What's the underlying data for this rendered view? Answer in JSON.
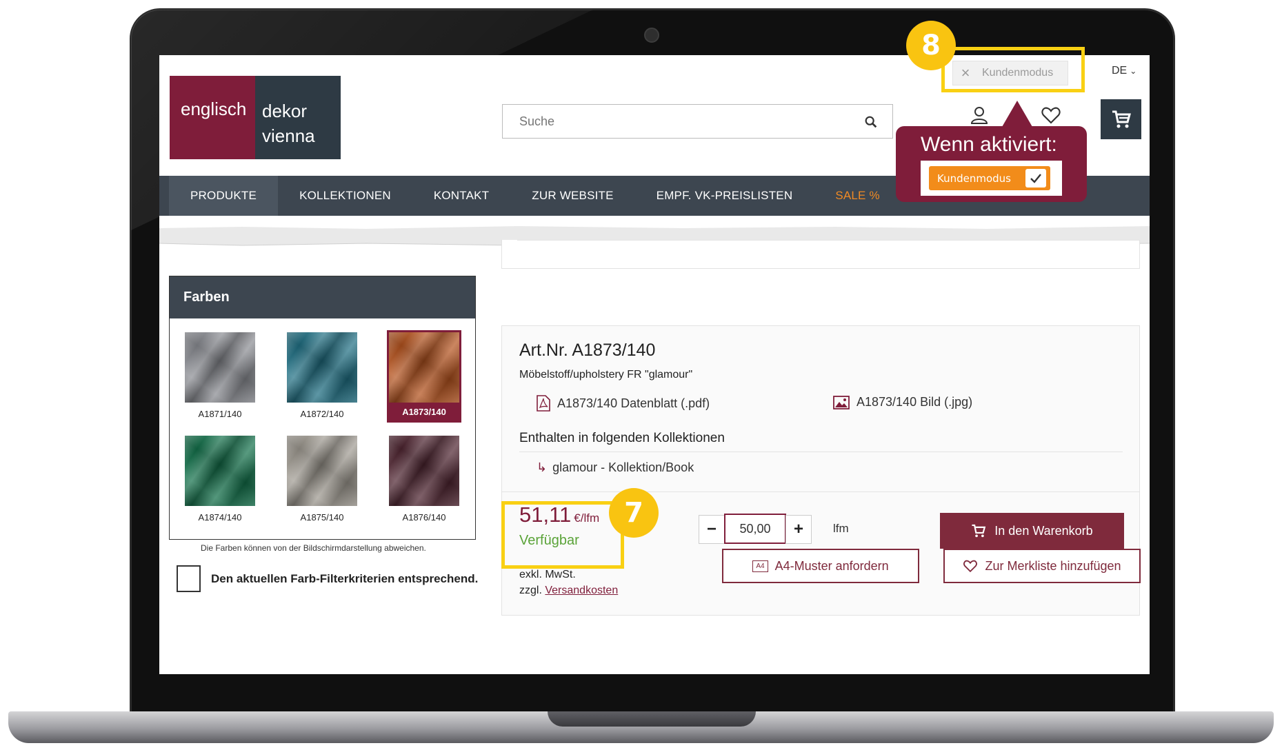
{
  "header": {
    "language": "DE",
    "logo": {
      "left": "englisch",
      "right_top": "dekor",
      "right_bottom": "vienna"
    },
    "search": {
      "placeholder": "Suche"
    },
    "kundenmodus": {
      "label": "Kundenmodus"
    }
  },
  "nav": {
    "items": [
      {
        "label": "PRODUKTE"
      },
      {
        "label": "KOLLEKTIONEN"
      },
      {
        "label": "KONTAKT"
      },
      {
        "label": "ZUR WEBSITE"
      },
      {
        "label": "EMPF. VK-PREISLISTEN"
      },
      {
        "label": "SALE %"
      }
    ]
  },
  "sidebar": {
    "title": "Farben",
    "swatches": [
      {
        "code": "A1871/140",
        "color": "#8a8c92"
      },
      {
        "code": "A1872/140",
        "color": "#1f6f83"
      },
      {
        "code": "A1873/140",
        "color": "#b5531e"
      },
      {
        "code": "A1874/140",
        "color": "#12704a"
      },
      {
        "code": "A1875/140",
        "color": "#9f9a91"
      },
      {
        "code": "A1876/140",
        "color": "#4e2430"
      }
    ],
    "note": "Die Farben können von der Bildschirmdarstellung abweichen.",
    "filter_label": "Den aktuellen Farb-Filterkriterien entsprechend."
  },
  "product": {
    "title": "Art.Nr. A1873/140",
    "subtitle": "Möbelstoff/upholstery FR \"glamour\"",
    "datasheet": "A1873/140 Datenblatt (.pdf)",
    "image": "A1873/140 Bild (.jpg)",
    "collections_heading": "Enthalten in folgenden Kollektionen",
    "collection_item": "glamour - Kollektion/Book",
    "price": "51,11",
    "price_unit": "€/lfm",
    "availability": "Verfügbar",
    "quantity": "50,00",
    "quantity_unit": "lfm",
    "add_to_cart": "In den Warenkorb",
    "tax": "exkl. MwSt.",
    "shipping_prefix": "zzgl.",
    "shipping_link": "Versandkosten",
    "sample_button": "A4-Muster anfordern",
    "sample_icon_text": "A4",
    "wishlist_button": "Zur Merkliste hinzufügen"
  },
  "annotations": {
    "badge_8": "8",
    "badge_7": "7",
    "callout_title": "Wenn aktiviert:",
    "callout_toggle_label": "Kundenmodus",
    "highlight_color": "#f9d013",
    "brand_color": "#7f1d3a",
    "accent_color": "#f28c1a"
  }
}
